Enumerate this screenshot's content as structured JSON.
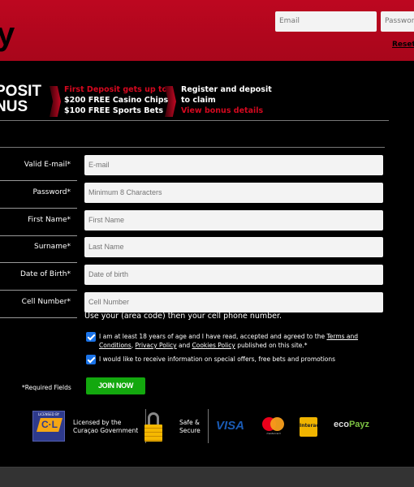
{
  "header": {
    "logo_fragment": "y",
    "email_placeholder": "Email",
    "password_placeholder": "Password",
    "reset_link": "Reset",
    "brand_color": "#bd0720"
  },
  "promo": {
    "big_text_line1": "POSIT",
    "big_text_line2": "NUS",
    "offer_heading": "First Deposit gets up to:",
    "offer_line1": "$200 FREE Casino Chips",
    "offer_line2": "$100 FREE Sports Bets",
    "cta_line1": "Register and deposit",
    "cta_line2": "to claim",
    "cta_link": "View bonus details"
  },
  "form": {
    "fields": [
      {
        "label": "Valid E-mail*",
        "placeholder": "E-mail",
        "value": ""
      },
      {
        "label": "Password*",
        "placeholder": "Minimum 8 Characters",
        "value": ""
      },
      {
        "label": "First Name*",
        "placeholder": "First Name",
        "value": ""
      },
      {
        "label": "Surname*",
        "placeholder": "Last Name",
        "value": ""
      },
      {
        "label": "Date of Birth*",
        "placeholder": "Date of birth",
        "value": ""
      },
      {
        "label": "Cell Number*",
        "placeholder": "Cell Number",
        "value": ""
      }
    ],
    "cell_hint": "Use your (area code) then your cell phone number.",
    "consent": {
      "checked": true,
      "text_prefix": "I am at least 18 years of age and I have read, accepted and agreed to the ",
      "terms_link": "Terms and Conditions",
      "sep1": ", ",
      "privacy_link": "Privacy Policy",
      "sep2": " and ",
      "cookies_link": "Cookies Policy",
      "text_suffix": " published on this site.*"
    },
    "marketing": {
      "checked": true,
      "text": "I would like to receive information on special offers, free bets and promotions"
    },
    "required_note": "*Required Fields",
    "join_button": "JOIN NOW",
    "join_color": "#13a80e"
  },
  "trust": {
    "license_badge_top": "LICENSED BY",
    "license_badge_mid": "C·L",
    "license_line1": "Licensed by the",
    "license_line2": "Curaçao Government",
    "secure_line1": "Safe &",
    "secure_line2": "Secure",
    "payments": [
      "VISA",
      "mastercard",
      "Interac",
      "ecoPayz"
    ],
    "ecopayz_eco": "eco",
    "ecopayz_payz": "Payz"
  }
}
